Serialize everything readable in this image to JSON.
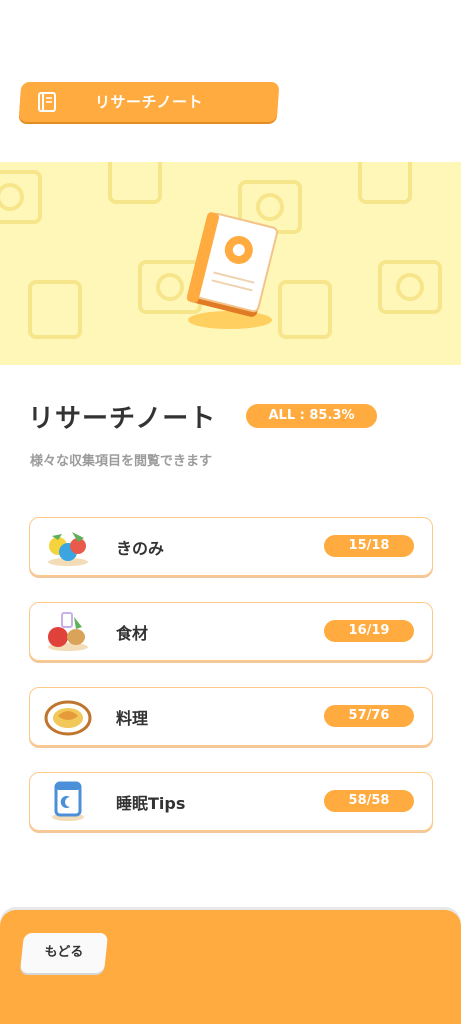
{
  "header": {
    "title": "リサーチノート",
    "icon": "notebook-icon"
  },
  "main": {
    "title": "リサーチノート",
    "all_badge": "ALL : 85.3%",
    "subtitle": "様々な収集項目を閲覧できます",
    "items": [
      {
        "label": "きのみ",
        "count": "15/18",
        "icon": "berries-icon"
      },
      {
        "label": "食材",
        "count": "16/19",
        "icon": "ingredients-icon"
      },
      {
        "label": "料理",
        "count": "57/76",
        "icon": "dish-icon"
      },
      {
        "label": "睡眠Tips",
        "count": "58/58",
        "icon": "sleep-tips-icon"
      }
    ]
  },
  "footer": {
    "back_label": "もどる"
  },
  "colors": {
    "accent": "#ffab40",
    "banner": "#fff7b8",
    "card_border": "#ffc98a"
  }
}
